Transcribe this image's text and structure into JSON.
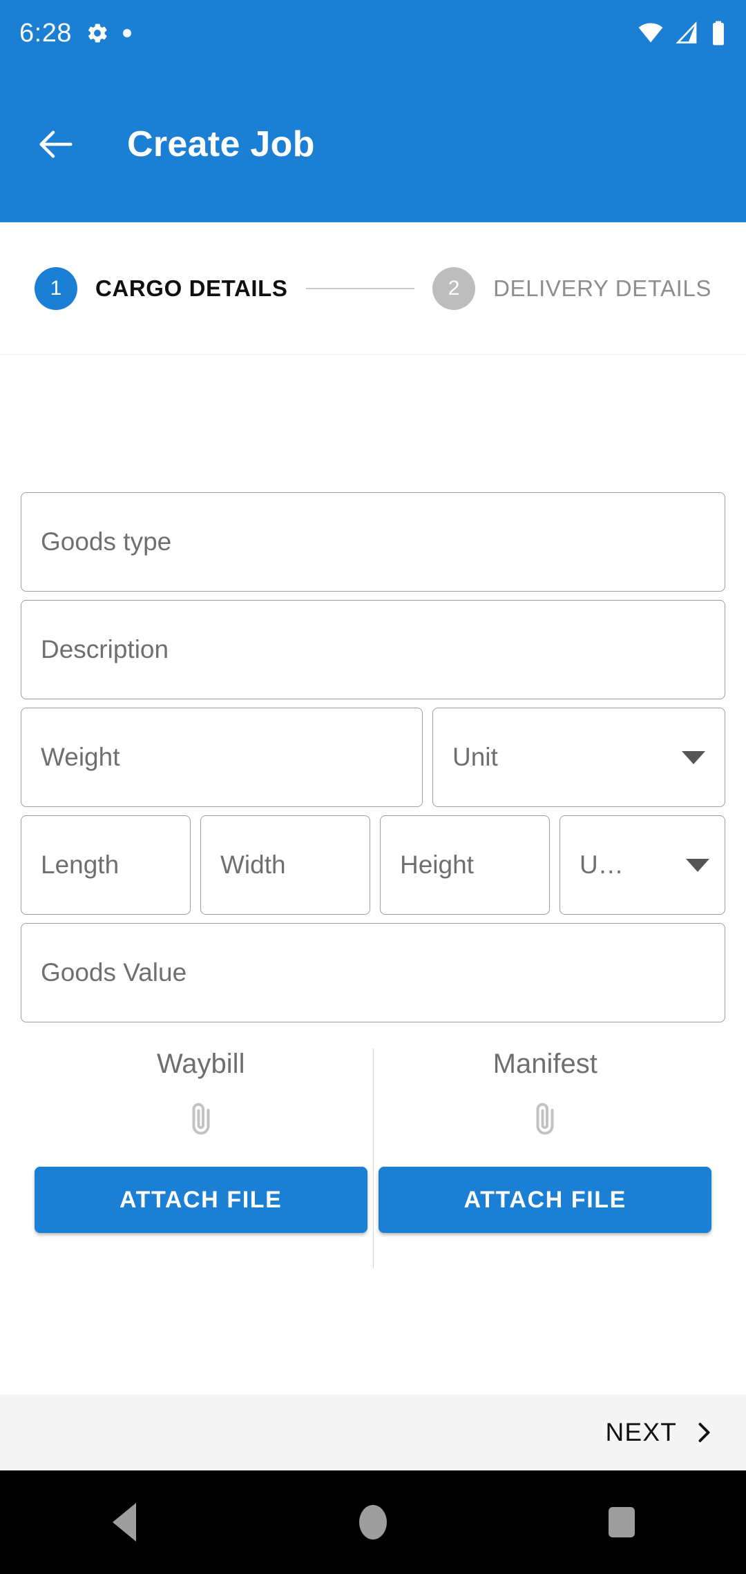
{
  "status_bar": {
    "time": "6:28",
    "icons_left": [
      "gear-icon",
      "dot-icon"
    ],
    "icons_right": [
      "wifi-icon",
      "cellular-signal-icon",
      "battery-icon"
    ]
  },
  "app_bar": {
    "back_icon": "arrow-back-icon",
    "title": "Create Job",
    "background_color": "#1b7fd4"
  },
  "stepper": {
    "steps": [
      {
        "number": "1",
        "label": "CARGO DETAILS",
        "state": "active"
      },
      {
        "number": "2",
        "label": "DELIVERY DETAILS",
        "state": "inactive"
      }
    ],
    "active_color": "#1b7fd4",
    "inactive_color": "#bdbdbd"
  },
  "form": {
    "goods_type": {
      "placeholder": "Goods type",
      "value": ""
    },
    "description": {
      "placeholder": "Description",
      "value": ""
    },
    "weight": {
      "placeholder": "Weight",
      "value": ""
    },
    "weight_unit": {
      "placeholder": "Unit",
      "value": "",
      "icon": "chevron-down-icon"
    },
    "length": {
      "placeholder": "Length",
      "value": ""
    },
    "width": {
      "placeholder": "Width",
      "value": ""
    },
    "height": {
      "placeholder": "Height",
      "value": ""
    },
    "dimension_unit": {
      "placeholder": "U…",
      "value": "",
      "icon": "chevron-down-icon"
    },
    "goods_value": {
      "placeholder": "Goods Value",
      "value": ""
    }
  },
  "attachments": [
    {
      "title": "Waybill",
      "icon": "paperclip-icon",
      "button_label": "ATTACH FILE"
    },
    {
      "title": "Manifest",
      "icon": "paperclip-icon",
      "button_label": "ATTACH FILE"
    }
  ],
  "bottom_bar": {
    "next_label": "NEXT",
    "next_icon": "chevron-right-icon"
  },
  "nav_bar": {
    "back": "triangle-back-icon",
    "home": "circle-home-icon",
    "recents": "square-recents-icon"
  },
  "colors": {
    "primary": "#1b7fd4",
    "field_border": "#9e9e9e",
    "placeholder": "#6f6f6f",
    "bottom_bar": "#f5f5f6"
  }
}
